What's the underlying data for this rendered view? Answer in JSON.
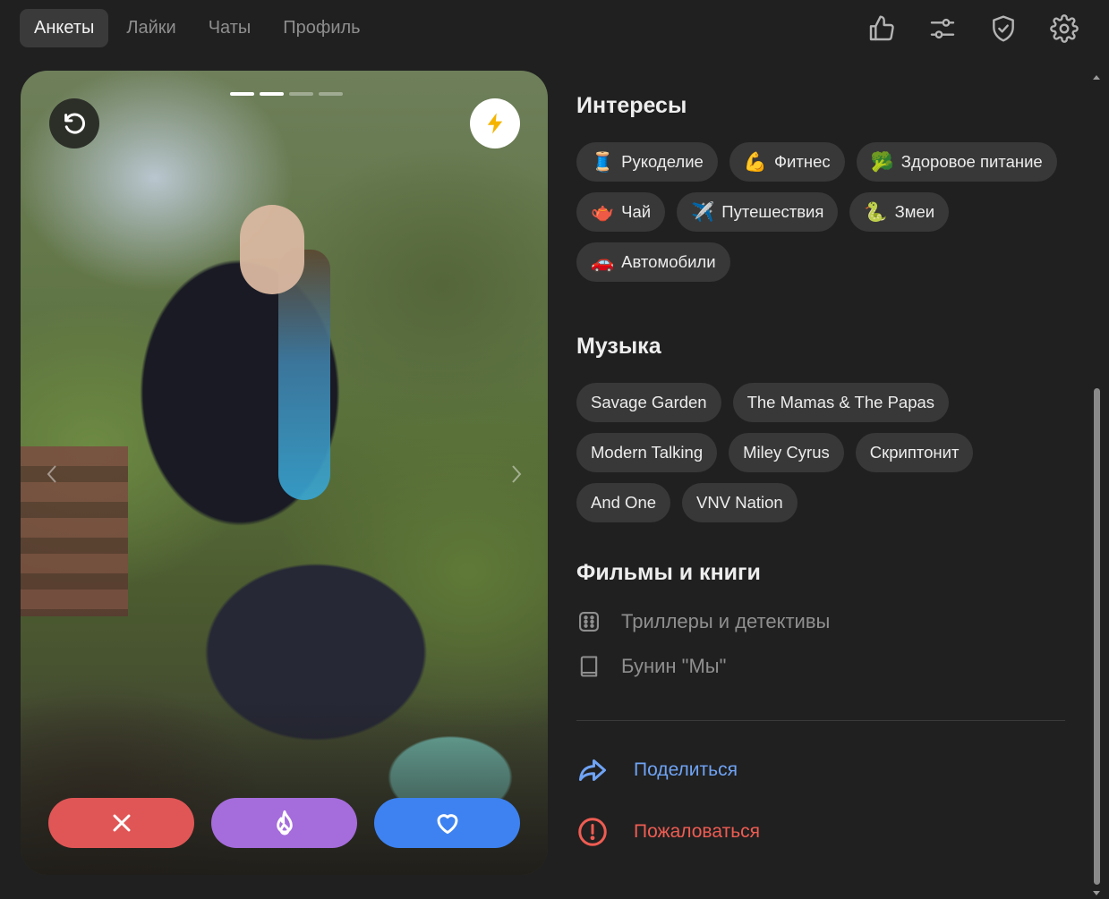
{
  "nav": {
    "tabs": [
      {
        "label": "Анкеты",
        "active": true
      },
      {
        "label": "Лайки",
        "active": false
      },
      {
        "label": "Чаты",
        "active": false
      },
      {
        "label": "Профиль",
        "active": false
      }
    ],
    "icons": [
      "thumbs-up-icon",
      "sliders-icon",
      "shield-check-icon",
      "gear-icon"
    ]
  },
  "card": {
    "photo_count": 4,
    "current_photo": 2,
    "actions": [
      "dislike",
      "superlike",
      "like"
    ]
  },
  "interests": {
    "title": "Интересы",
    "items": [
      {
        "emoji": "🧵",
        "label": "Рукоделие"
      },
      {
        "emoji": "💪",
        "label": "Фитнес"
      },
      {
        "emoji": "🥦",
        "label": "Здоровое питание"
      },
      {
        "emoji": "🫖",
        "label": "Чай"
      },
      {
        "emoji": "✈️",
        "label": "Путешествия"
      },
      {
        "emoji": "🐍",
        "label": "Змеи"
      },
      {
        "emoji": "🚗",
        "label": "Автомобили"
      }
    ]
  },
  "music": {
    "title": "Музыка",
    "items": [
      "Savage Garden",
      "The Mamas & The Papas",
      "Modern Talking",
      "Miley Cyrus",
      "Скриптонит",
      "And One",
      "VNV Nation"
    ]
  },
  "films_books": {
    "title": "Фильмы и книги",
    "films": "Триллеры и детективы",
    "books": "Бунин \"Мы\""
  },
  "links": {
    "share": "Поделиться",
    "report": "Пожаловаться"
  },
  "colors": {
    "background": "#202020",
    "chip": "#383838",
    "dislike": "#e05656",
    "superlike": "#a56cdc",
    "like": "#3d82f0",
    "share": "#6fa3f5",
    "report": "#ef5c52",
    "boost": "#f5b400"
  }
}
